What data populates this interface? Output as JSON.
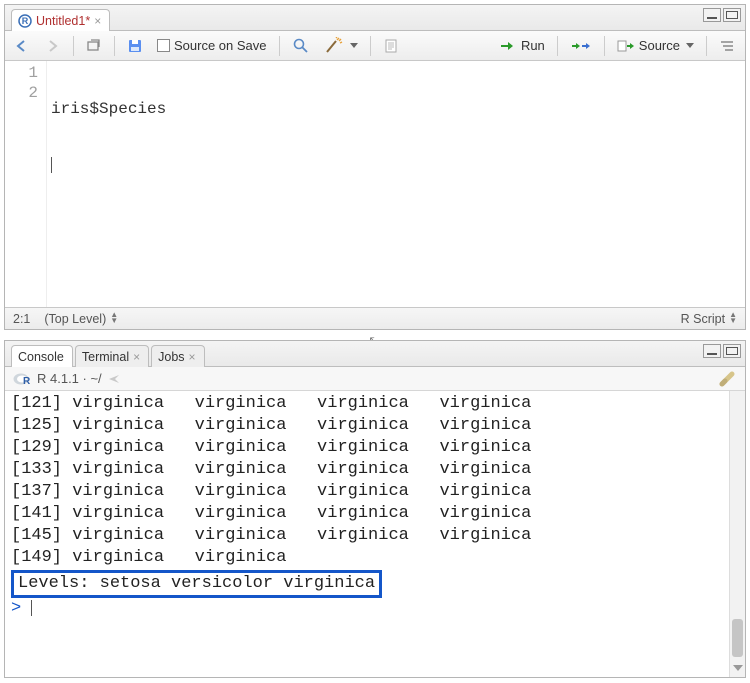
{
  "source": {
    "tab_title": "Untitled1",
    "tab_dirty_marker": "*",
    "toolbar": {
      "source_on_save": "Source on Save",
      "run": "Run",
      "source_btn": "Source"
    },
    "lines": [
      "iris$Species",
      ""
    ],
    "line_numbers": [
      "1",
      "2"
    ],
    "status": {
      "pos": "2:1",
      "scope": "(Top Level)",
      "lang": "R Script"
    }
  },
  "console": {
    "tabs": {
      "console": "Console",
      "terminal": "Terminal",
      "jobs": "Jobs"
    },
    "info": "R 4.1.1 · ~/",
    "rows": [
      {
        "idx": "[121]",
        "vals": [
          "virginica",
          "virginica",
          "virginica",
          "virginica"
        ]
      },
      {
        "idx": "[125]",
        "vals": [
          "virginica",
          "virginica",
          "virginica",
          "virginica"
        ]
      },
      {
        "idx": "[129]",
        "vals": [
          "virginica",
          "virginica",
          "virginica",
          "virginica"
        ]
      },
      {
        "idx": "[133]",
        "vals": [
          "virginica",
          "virginica",
          "virginica",
          "virginica"
        ]
      },
      {
        "idx": "[137]",
        "vals": [
          "virginica",
          "virginica",
          "virginica",
          "virginica"
        ]
      },
      {
        "idx": "[141]",
        "vals": [
          "virginica",
          "virginica",
          "virginica",
          "virginica"
        ]
      },
      {
        "idx": "[145]",
        "vals": [
          "virginica",
          "virginica",
          "virginica",
          "virginica"
        ]
      },
      {
        "idx": "[149]",
        "vals": [
          "virginica",
          "virginica"
        ]
      }
    ],
    "levels": "Levels: setosa versicolor virginica",
    "prompt": ">"
  }
}
